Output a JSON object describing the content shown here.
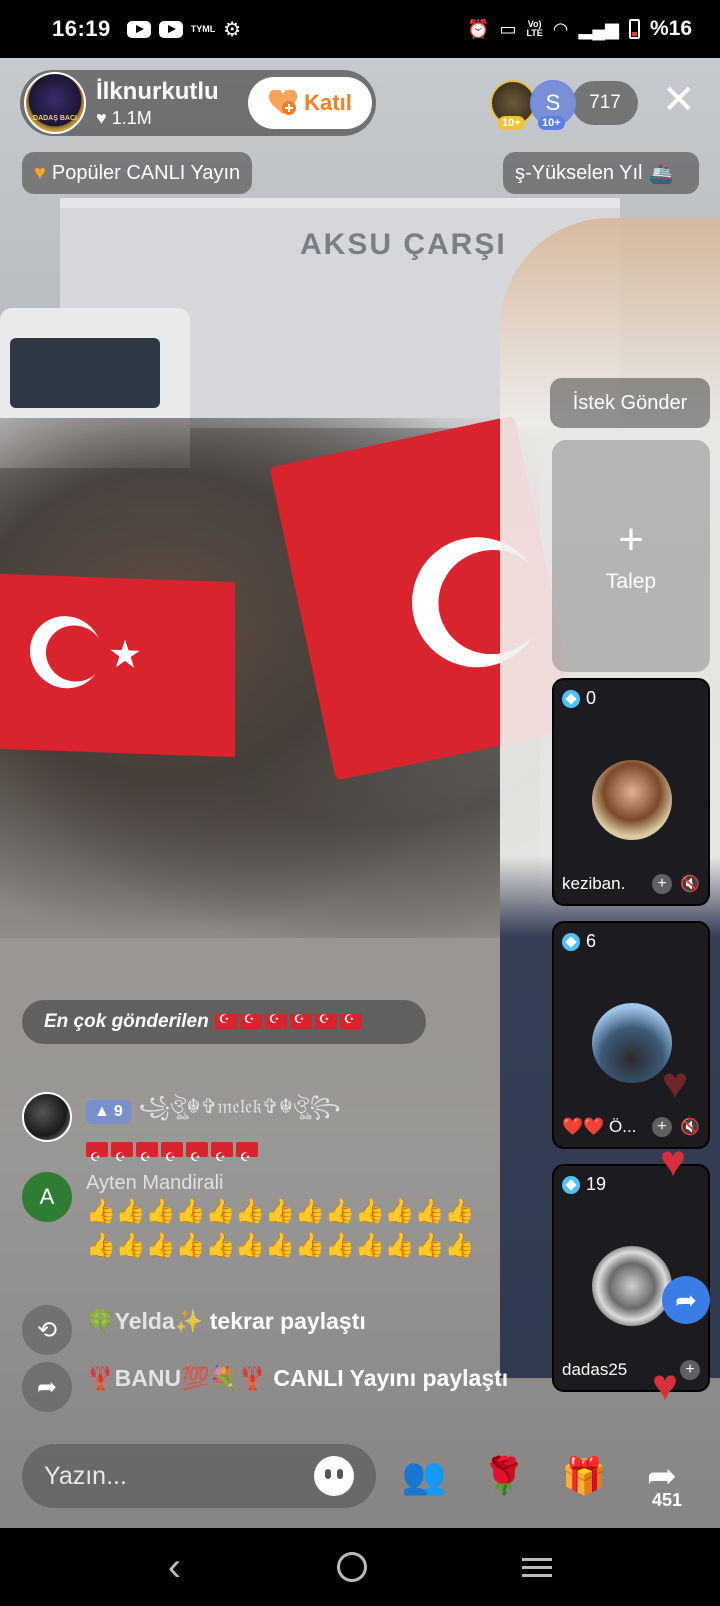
{
  "status_bar": {
    "time": "16:19",
    "tyml": "TYML",
    "battery": "%16",
    "lte_top": "Vo)",
    "lte_bottom": "LTE"
  },
  "host": {
    "name": "İlknurkutlu",
    "likes": "1.1M",
    "avatar_text": "DADAŞ BACI",
    "join_label": "Katıl"
  },
  "viewers": {
    "avatar_letter": "S",
    "badge1": "10+",
    "badge2": "10+",
    "count": "717"
  },
  "chips": {
    "popular": "Popüler CANLI Yayın",
    "rising": "ş-Yükselen Yıl"
  },
  "video": {
    "sign_text": "AKSU ÇARŞI"
  },
  "right_panel": {
    "request_button": "İstek Gönder",
    "request_card_label": "Talep",
    "request_plus": "+",
    "guests": [
      {
        "score": "0",
        "name": "keziban."
      },
      {
        "score": "6",
        "name": "❤️❤️ Ö..."
      },
      {
        "score": "19",
        "name": "dadas25"
      }
    ]
  },
  "chat": {
    "top_sent_label": "En çok gönderilen",
    "messages": [
      {
        "level": "9",
        "user": "꧁ঔৣ☬✞𝔪𝔢𝔩𝔢𝔨✞☬ঔৣ꧂",
        "avatar_letter": ""
      },
      {
        "level": "",
        "user": "Ayten Mandirali",
        "avatar_letter": "A",
        "text": "👍👍👍👍👍👍👍👍👍👍👍👍👍👍👍👍👍👍👍👍👍👍👍👍👍👍"
      }
    ],
    "events": [
      {
        "who": "🍀Yelda✨",
        "action": "tekrar paylaştı"
      },
      {
        "who": "🦞BANU💯💐🦞",
        "action": "CANLI Yayını paylaştı"
      }
    ]
  },
  "bottom_bar": {
    "input_placeholder": "Yazın...",
    "share_count": "451"
  },
  "colors": {
    "accent_orange": "#f57c1f",
    "flag_red": "#d9232d",
    "heart_red": "#d6303a",
    "tiktok_pink": "#fe2c55"
  }
}
